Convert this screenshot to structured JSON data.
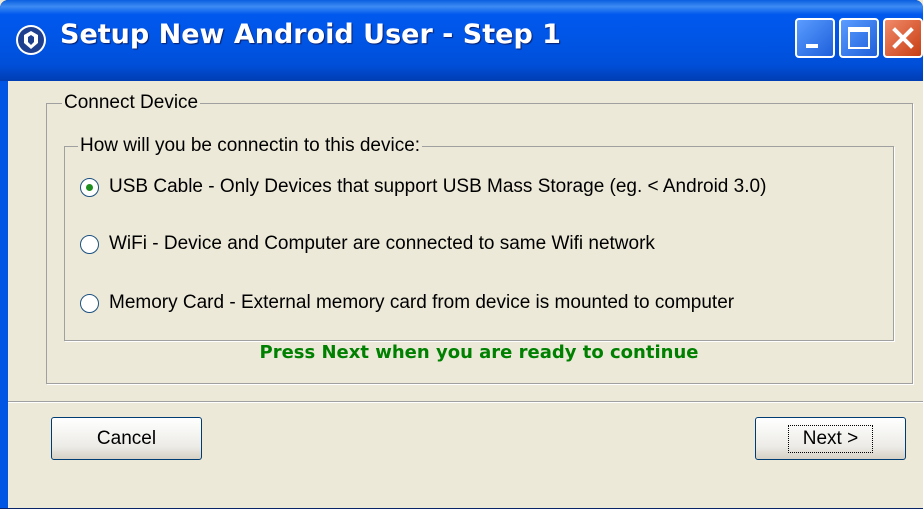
{
  "window": {
    "title": "Setup New Android User - Step 1",
    "accent_color": "#0055E5"
  },
  "title_buttons": {
    "minimize_icon": "minimize-icon",
    "maximize_icon": "maximize-icon",
    "close_icon": "close-icon"
  },
  "group": {
    "legend": "Connect Device",
    "inner_legend": "How will you be connectin to this device:"
  },
  "options": [
    {
      "label": "USB Cable - Only Devices that support USB Mass Storage (eg. < Android 3.0)",
      "checked": true
    },
    {
      "label": "WiFi - Device and Computer are connected to same Wifi network",
      "checked": false
    },
    {
      "label": "Memory Card - External memory card from device is mounted to computer",
      "checked": false
    }
  ],
  "prompt": {
    "text": "Press Next when you are ready to continue",
    "color": "#008000"
  },
  "buttons": {
    "cancel": "Cancel",
    "next": "Next >"
  }
}
